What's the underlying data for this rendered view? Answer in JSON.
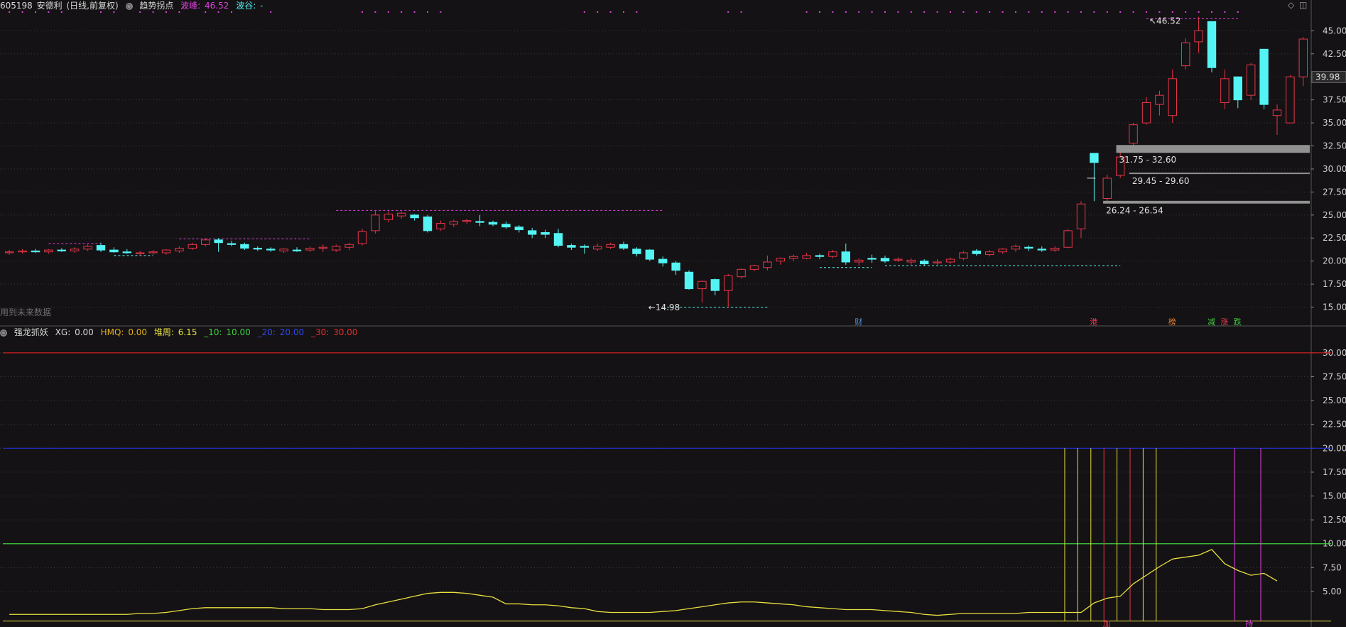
{
  "main_header": {
    "code": "605198",
    "name": "安德利",
    "period": "(日线,前复权)",
    "indicator": "趋势拐点",
    "peak_label": "波峰:",
    "peak_value": "46.52",
    "trough_label": "波谷:",
    "trough_value": "-"
  },
  "sub_header": {
    "indicator": "强龙抓妖",
    "xg_label": "XG:",
    "xg_value": "0.00",
    "hmq_label": "HMQ:",
    "hmq_value": "0.00",
    "dz_label": "堆周:",
    "dz_value": "6.15",
    "p10_label": "_10:",
    "p10_value": "10.00",
    "p20_label": "_20:",
    "p20_value": "20.00",
    "p30_label": "_30:",
    "p30_value": "30.00"
  },
  "notice": "用到未来数据",
  "current_price": "39.98",
  "colors": {
    "background": "#141214",
    "up": "#e8364a",
    "down": "#54f4f4",
    "grid": "#3a3a3a",
    "magenta": "#e040e0",
    "yellow": "#e8e040",
    "green": "#40d040",
    "blue": "#2030d0",
    "red_line": "#d02020",
    "axis_text": "#d0d0d0"
  },
  "chart_data": [
    {
      "type": "candlestick",
      "title": "605198 安德利 (日线,前复权)",
      "ylim": [
        13.5,
        46.8
      ],
      "y_ticks": [
        "15.00",
        "17.50",
        "20.00",
        "22.50",
        "25.00",
        "27.50",
        "30.00",
        "32.50",
        "35.00",
        "37.50",
        "40.00",
        "42.50",
        "45.00"
      ],
      "grid": true,
      "candles": [
        {
          "o": 20.9,
          "h": 21.2,
          "l": 20.7,
          "c": 21.0
        },
        {
          "o": 21.0,
          "h": 21.3,
          "l": 20.8,
          "c": 21.1
        },
        {
          "o": 21.1,
          "h": 21.3,
          "l": 20.9,
          "c": 21.0
        },
        {
          "o": 21.0,
          "h": 21.3,
          "l": 20.8,
          "c": 21.2
        },
        {
          "o": 21.2,
          "h": 21.4,
          "l": 21.0,
          "c": 21.1
        },
        {
          "o": 21.1,
          "h": 21.5,
          "l": 20.9,
          "c": 21.3
        },
        {
          "o": 21.3,
          "h": 21.8,
          "l": 21.1,
          "c": 21.6
        },
        {
          "o": 21.7,
          "h": 22.0,
          "l": 21.0,
          "c": 21.2
        },
        {
          "o": 21.2,
          "h": 21.5,
          "l": 20.9,
          "c": 21.0
        },
        {
          "o": 21.0,
          "h": 21.3,
          "l": 20.8,
          "c": 20.9
        },
        {
          "o": 20.8,
          "h": 21.1,
          "l": 20.6,
          "c": 20.9
        },
        {
          "o": 20.9,
          "h": 21.2,
          "l": 20.7,
          "c": 21.0
        },
        {
          "o": 20.9,
          "h": 21.3,
          "l": 20.7,
          "c": 21.2
        },
        {
          "o": 21.1,
          "h": 21.6,
          "l": 20.9,
          "c": 21.4
        },
        {
          "o": 21.4,
          "h": 22.0,
          "l": 21.2,
          "c": 21.8
        },
        {
          "o": 21.8,
          "h": 22.5,
          "l": 21.6,
          "c": 22.3
        },
        {
          "o": 22.3,
          "h": 22.5,
          "l": 21.0,
          "c": 22.0
        },
        {
          "o": 21.9,
          "h": 22.2,
          "l": 21.6,
          "c": 21.8
        },
        {
          "o": 21.8,
          "h": 22.0,
          "l": 21.2,
          "c": 21.4
        },
        {
          "o": 21.4,
          "h": 21.6,
          "l": 21.1,
          "c": 21.3
        },
        {
          "o": 21.3,
          "h": 21.5,
          "l": 21.0,
          "c": 21.2
        },
        {
          "o": 21.1,
          "h": 21.4,
          "l": 20.9,
          "c": 21.3
        },
        {
          "o": 21.2,
          "h": 21.5,
          "l": 21.0,
          "c": 21.1
        },
        {
          "o": 21.2,
          "h": 21.6,
          "l": 21.0,
          "c": 21.4
        },
        {
          "o": 21.4,
          "h": 21.8,
          "l": 21.0,
          "c": 21.5
        },
        {
          "o": 21.2,
          "h": 21.8,
          "l": 21.0,
          "c": 21.6
        },
        {
          "o": 21.5,
          "h": 22.0,
          "l": 21.2,
          "c": 21.8
        },
        {
          "o": 21.9,
          "h": 23.5,
          "l": 21.7,
          "c": 23.2
        },
        {
          "o": 23.3,
          "h": 25.5,
          "l": 23.0,
          "c": 25.0
        },
        {
          "o": 24.5,
          "h": 25.4,
          "l": 24.2,
          "c": 25.1
        },
        {
          "o": 24.9,
          "h": 25.4,
          "l": 24.6,
          "c": 25.2
        },
        {
          "o": 25.0,
          "h": 25.1,
          "l": 24.4,
          "c": 24.7
        },
        {
          "o": 24.8,
          "h": 25.0,
          "l": 23.1,
          "c": 23.3
        },
        {
          "o": 23.5,
          "h": 24.4,
          "l": 23.3,
          "c": 24.1
        },
        {
          "o": 24.0,
          "h": 24.5,
          "l": 23.7,
          "c": 24.3
        },
        {
          "o": 24.3,
          "h": 24.6,
          "l": 24.0,
          "c": 24.4
        },
        {
          "o": 24.3,
          "h": 25.0,
          "l": 23.8,
          "c": 24.2
        },
        {
          "o": 24.2,
          "h": 24.4,
          "l": 23.8,
          "c": 24.0
        },
        {
          "o": 24.0,
          "h": 24.3,
          "l": 23.5,
          "c": 23.7
        },
        {
          "o": 23.7,
          "h": 23.9,
          "l": 23.1,
          "c": 23.4
        },
        {
          "o": 23.3,
          "h": 23.6,
          "l": 22.5,
          "c": 22.9
        },
        {
          "o": 23.1,
          "h": 23.4,
          "l": 22.5,
          "c": 22.9
        },
        {
          "o": 23.0,
          "h": 23.5,
          "l": 21.5,
          "c": 21.7
        },
        {
          "o": 21.7,
          "h": 21.9,
          "l": 21.2,
          "c": 21.5
        },
        {
          "o": 21.6,
          "h": 21.8,
          "l": 20.8,
          "c": 21.5
        },
        {
          "o": 21.3,
          "h": 21.9,
          "l": 21.1,
          "c": 21.6
        },
        {
          "o": 21.5,
          "h": 22.0,
          "l": 21.3,
          "c": 21.8
        },
        {
          "o": 21.8,
          "h": 22.1,
          "l": 21.2,
          "c": 21.4
        },
        {
          "o": 21.3,
          "h": 21.5,
          "l": 20.5,
          "c": 20.8
        },
        {
          "o": 21.2,
          "h": 21.3,
          "l": 20.0,
          "c": 20.2
        },
        {
          "o": 20.2,
          "h": 20.5,
          "l": 19.4,
          "c": 19.8
        },
        {
          "o": 19.8,
          "h": 20.0,
          "l": 18.5,
          "c": 19.0
        },
        {
          "o": 18.8,
          "h": 19.0,
          "l": 16.9,
          "c": 17.0
        },
        {
          "o": 17.0,
          "h": 17.9,
          "l": 15.5,
          "c": 17.8
        },
        {
          "o": 18.0,
          "h": 18.1,
          "l": 16.3,
          "c": 16.8
        },
        {
          "o": 16.8,
          "h": 18.6,
          "l": 14.98,
          "c": 18.4
        },
        {
          "o": 18.3,
          "h": 19.2,
          "l": 18.1,
          "c": 19.1
        },
        {
          "o": 19.1,
          "h": 19.6,
          "l": 18.9,
          "c": 19.5
        },
        {
          "o": 19.3,
          "h": 20.6,
          "l": 19.0,
          "c": 19.9
        },
        {
          "o": 20.0,
          "h": 20.4,
          "l": 19.6,
          "c": 20.3
        },
        {
          "o": 20.3,
          "h": 20.7,
          "l": 20.0,
          "c": 20.5
        },
        {
          "o": 20.3,
          "h": 20.9,
          "l": 20.2,
          "c": 20.6
        },
        {
          "o": 20.6,
          "h": 20.8,
          "l": 20.2,
          "c": 20.5
        },
        {
          "o": 20.5,
          "h": 21.2,
          "l": 20.3,
          "c": 21.0
        },
        {
          "o": 21.0,
          "h": 21.9,
          "l": 19.6,
          "c": 19.9
        },
        {
          "o": 19.9,
          "h": 20.3,
          "l": 19.5,
          "c": 20.1
        },
        {
          "o": 20.3,
          "h": 20.7,
          "l": 19.8,
          "c": 20.2
        },
        {
          "o": 20.3,
          "h": 20.6,
          "l": 19.8,
          "c": 20.0
        },
        {
          "o": 20.1,
          "h": 20.4,
          "l": 19.9,
          "c": 20.2
        },
        {
          "o": 19.9,
          "h": 20.3,
          "l": 19.6,
          "c": 20.1
        },
        {
          "o": 20.0,
          "h": 20.2,
          "l": 19.5,
          "c": 19.7
        },
        {
          "o": 19.8,
          "h": 20.2,
          "l": 19.6,
          "c": 19.9
        },
        {
          "o": 19.9,
          "h": 20.4,
          "l": 19.7,
          "c": 20.2
        },
        {
          "o": 20.3,
          "h": 21.1,
          "l": 20.1,
          "c": 20.9
        },
        {
          "o": 21.1,
          "h": 21.3,
          "l": 20.6,
          "c": 20.8
        },
        {
          "o": 20.7,
          "h": 21.2,
          "l": 20.5,
          "c": 21.0
        },
        {
          "o": 21.0,
          "h": 21.4,
          "l": 20.8,
          "c": 21.3
        },
        {
          "o": 21.3,
          "h": 21.8,
          "l": 21.0,
          "c": 21.6
        },
        {
          "o": 21.5,
          "h": 21.7,
          "l": 21.1,
          "c": 21.4
        },
        {
          "o": 21.3,
          "h": 21.6,
          "l": 21.0,
          "c": 21.2
        },
        {
          "o": 21.2,
          "h": 21.6,
          "l": 21.0,
          "c": 21.4
        },
        {
          "o": 21.5,
          "h": 23.5,
          "l": 21.4,
          "c": 23.3
        },
        {
          "o": 23.5,
          "h": 26.5,
          "l": 22.5,
          "c": 26.2
        },
        {
          "o": 31.7,
          "h": 31.7,
          "l": 26.5,
          "c": 30.7
        },
        {
          "o": 26.8,
          "h": 29.4,
          "l": 26.5,
          "c": 29.0
        },
        {
          "o": 29.3,
          "h": 31.8,
          "l": 29.0,
          "c": 31.3
        },
        {
          "o": 32.8,
          "h": 35.0,
          "l": 32.5,
          "c": 34.8
        },
        {
          "o": 35.0,
          "h": 37.8,
          "l": 34.8,
          "c": 37.2
        },
        {
          "o": 37.0,
          "h": 38.5,
          "l": 35.8,
          "c": 38.0
        },
        {
          "o": 35.8,
          "h": 40.8,
          "l": 35.0,
          "c": 39.8
        },
        {
          "o": 41.2,
          "h": 44.2,
          "l": 40.8,
          "c": 43.7
        },
        {
          "o": 43.8,
          "h": 46.52,
          "l": 42.6,
          "c": 45.0
        },
        {
          "o": 46.0,
          "h": 46.0,
          "l": 40.5,
          "c": 41.0
        },
        {
          "o": 37.2,
          "h": 40.8,
          "l": 36.5,
          "c": 39.8
        },
        {
          "o": 40.0,
          "h": 40.0,
          "l": 36.6,
          "c": 37.5
        },
        {
          "o": 38.0,
          "h": 41.5,
          "l": 37.5,
          "c": 41.3
        },
        {
          "o": 43.0,
          "h": 43.0,
          "l": 36.5,
          "c": 37.0
        },
        {
          "o": 35.8,
          "h": 37.0,
          "l": 33.7,
          "c": 36.4
        },
        {
          "o": 35.0,
          "h": 40.2,
          "l": 35.0,
          "c": 40.0
        },
        {
          "o": 40.0,
          "h": 44.3,
          "l": 39.0,
          "c": 44.1
        }
      ],
      "annotations": [
        {
          "text": "46.52",
          "value": 46.52,
          "kind": "peak"
        },
        {
          "text": "14.98",
          "value": 14.98,
          "kind": "trough"
        }
      ],
      "zones": [
        {
          "text": "31.75 - 32.60",
          "low": 31.75,
          "high": 32.6
        },
        {
          "text": "29.45 - 29.60",
          "low": 29.45,
          "high": 29.6
        },
        {
          "text": "26.24 - 26.54",
          "low": 26.24,
          "high": 26.54
        }
      ],
      "event_labels": [
        {
          "text": "财",
          "index": 65,
          "color": "#5090e0"
        },
        {
          "text": "港",
          "index": 83,
          "color": "#e8364a"
        },
        {
          "text": "榜",
          "index": 89,
          "color": "#e08030"
        },
        {
          "text": "减",
          "index": 92,
          "color": "#40d040"
        },
        {
          "text": "涨",
          "index": 93,
          "color": "#e8364a"
        },
        {
          "text": "跌",
          "index": 94,
          "color": "#40d040"
        }
      ]
    },
    {
      "type": "line",
      "title": "强龙抓妖",
      "ylim": [
        1.5,
        32
      ],
      "y_ticks": [
        "5.00",
        "7.50",
        "10.00",
        "12.50",
        "15.00",
        "17.50",
        "20.00",
        "22.50",
        "25.00",
        "27.50",
        "30.00"
      ],
      "reference_lines": [
        {
          "name": "_10",
          "value": 10,
          "color": "#40d040"
        },
        {
          "name": "_20",
          "value": 20,
          "color": "#2030d0"
        },
        {
          "name": "_30",
          "value": 30,
          "color": "#d02020"
        }
      ],
      "series": [
        {
          "name": "堆周",
          "color": "#e8e040",
          "values": [
            2.6,
            2.6,
            2.6,
            2.6,
            2.6,
            2.6,
            2.6,
            2.6,
            2.6,
            2.6,
            2.7,
            2.7,
            2.8,
            3.0,
            3.2,
            3.3,
            3.3,
            3.3,
            3.3,
            3.3,
            3.3,
            3.2,
            3.2,
            3.2,
            3.1,
            3.1,
            3.1,
            3.2,
            3.6,
            3.9,
            4.2,
            4.5,
            4.8,
            4.9,
            4.9,
            4.8,
            4.6,
            4.4,
            3.7,
            3.7,
            3.6,
            3.6,
            3.5,
            3.3,
            3.2,
            2.9,
            2.8,
            2.8,
            2.8,
            2.8,
            2.9,
            3.0,
            3.2,
            3.4,
            3.6,
            3.8,
            3.9,
            3.9,
            3.8,
            3.7,
            3.6,
            3.4,
            3.3,
            3.2,
            3.1,
            3.1,
            3.1,
            3.0,
            2.9,
            2.8,
            2.6,
            2.5,
            2.6,
            2.7,
            2.7,
            2.7,
            2.7,
            2.7,
            2.8,
            2.8,
            2.8,
            2.8,
            2.8,
            3.8,
            4.3,
            4.5,
            5.8,
            6.7,
            7.6,
            8.4,
            8.6,
            8.8,
            9.4,
            7.9,
            7.2,
            6.7,
            6.9,
            6.1
          ]
        }
      ],
      "signal_lines": [
        {
          "index": 81,
          "color": "#e8e040"
        },
        {
          "index": 82,
          "color": "#e8e040"
        },
        {
          "index": 83,
          "color": "#e8e040"
        },
        {
          "index": 84,
          "color": "#e8364a"
        },
        {
          "index": 85,
          "color": "#e8e040"
        },
        {
          "index": 86,
          "color": "#e8364a"
        },
        {
          "index": 87,
          "color": "#e8e040"
        },
        {
          "index": 88,
          "color": "#e8e040"
        },
        {
          "index": 94,
          "color": "#e040e0"
        },
        {
          "index": 96,
          "color": "#e040e0"
        }
      ],
      "markers": [
        {
          "text": "加",
          "color": "#e8364a"
        },
        {
          "text": "持",
          "color": "#e040e0"
        }
      ]
    }
  ]
}
